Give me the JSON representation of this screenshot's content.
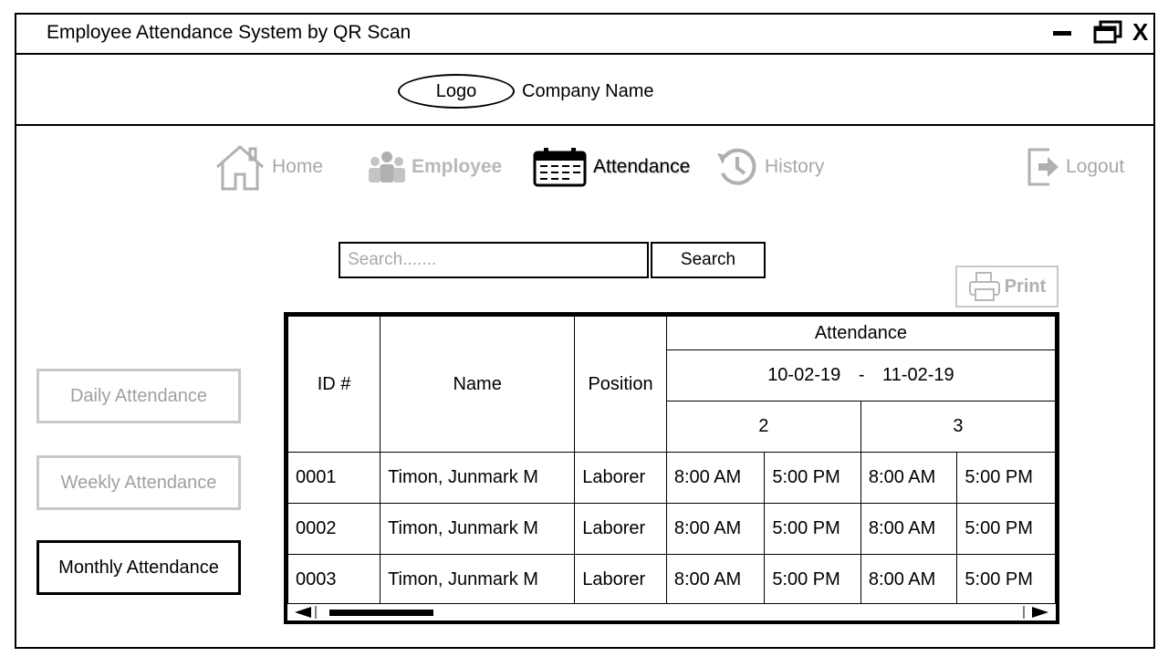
{
  "window": {
    "title": "Employee Attendance System by QR Scan",
    "minimize": "–",
    "close": "X"
  },
  "header": {
    "logo": "Logo",
    "company_name": "Company Name"
  },
  "nav": {
    "home": "Home",
    "employee": "Employee",
    "attendance": "Attendance",
    "history": "History",
    "logout": "Logout"
  },
  "search": {
    "placeholder": "Search.......",
    "button": "Search"
  },
  "print": {
    "label": "Print"
  },
  "sidebar": {
    "daily": "Daily Attendance",
    "weekly": "Weekly Attendance",
    "monthly": "Monthly Attendance"
  },
  "table": {
    "headers": {
      "id": "ID #",
      "name": "Name",
      "position": "Position",
      "attendance": "Attendance"
    },
    "range": {
      "start": "10-02-19",
      "sep": "-",
      "end": "11-02-19"
    },
    "days": [
      "2",
      "3"
    ],
    "rows": [
      {
        "id": "0001",
        "name": "Timon, Junmark M",
        "position": "Laborer",
        "d2_in": "8:00 AM",
        "d2_out": "5:00 PM",
        "d3_in": "8:00 AM",
        "d3_out": "5:00 PM"
      },
      {
        "id": "0002",
        "name": "Timon, Junmark M",
        "position": "Laborer",
        "d2_in": "8:00 AM",
        "d2_out": "5:00 PM",
        "d3_in": "8:00 AM",
        "d3_out": "5:00 PM"
      },
      {
        "id": "0003",
        "name": "Timon, Junmark M",
        "position": "Laborer",
        "d2_in": "8:00 AM",
        "d2_out": "5:00 PM",
        "d3_in": "8:00 AM",
        "d3_out": "5:00 PM"
      }
    ]
  },
  "icons": {
    "home": "home-icon",
    "employee": "employees-icon",
    "attendance": "calendar-icon",
    "history": "history-icon",
    "logout": "logout-icon",
    "print": "printer-icon"
  }
}
